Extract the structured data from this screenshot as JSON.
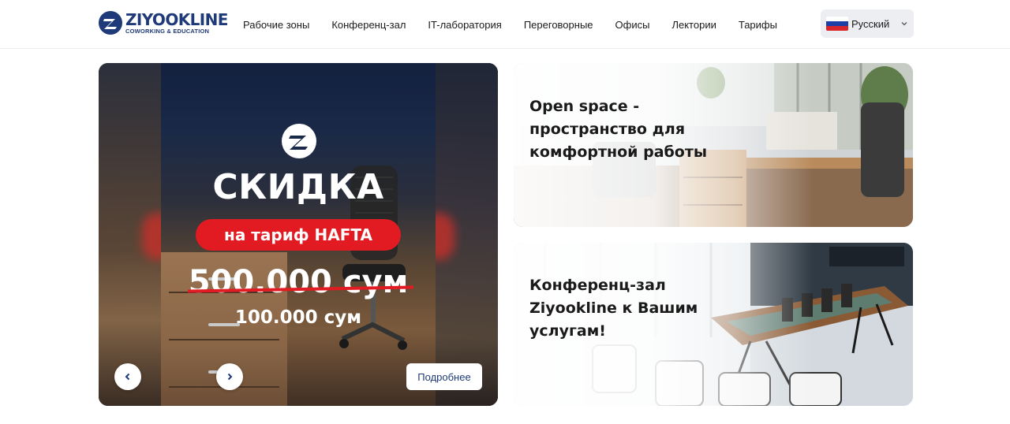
{
  "header": {
    "logo": {
      "title": "ZIYOOKLINE",
      "subtitle": "COWORKING & EDUCATION",
      "icon": "ziyookline-logo-icon"
    },
    "nav": [
      {
        "label": "Рабочие зоны"
      },
      {
        "label": "Конференц-зал"
      },
      {
        "label": "IT-лаборатория"
      },
      {
        "label": "Переговорные"
      },
      {
        "label": "Офисы"
      },
      {
        "label": "Лектории"
      },
      {
        "label": "Тарифы"
      }
    ],
    "language": {
      "label": "Русский",
      "flag": "russia-flag-icon",
      "caret": "chevron-down-icon"
    }
  },
  "hero": {
    "poster": {
      "title": "СКИДКА",
      "pill": "на тариф HAFTA",
      "old_price": "500.000 сум",
      "new_price": "100.000 сум"
    },
    "prev_icon": "chevron-left-icon",
    "next_icon": "chevron-right-icon",
    "more_label": "Подробнее"
  },
  "cards": [
    {
      "title": "Open space - пространство для комфортной работы"
    },
    {
      "title": "Конференц-зал Ziyookline к Вашим услугам!"
    }
  ],
  "colors": {
    "brand": "#1f3a78",
    "accent_red": "#e21a22",
    "lang_bg": "#eceef2"
  }
}
